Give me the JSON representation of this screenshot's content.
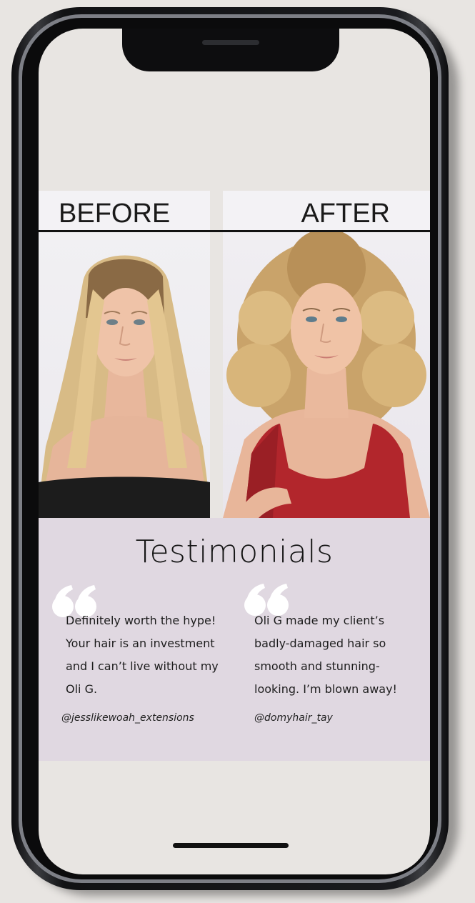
{
  "before_after": {
    "before_label": "BEFORE",
    "after_label": "AFTER"
  },
  "testimonials": {
    "title": "Testimonials",
    "items": [
      {
        "quote": "Definitely worth the hype!\nYour hair is an investment\nand I can’t live without my\nOli G.",
        "handle": "@jesslikewoah_extensions"
      },
      {
        "quote": "Oli G made my client’s\nbadly-damaged hair so\nsmooth and stunning-\nlooking. I’m blown away!",
        "handle": "@domyhair_tay"
      }
    ]
  },
  "colors": {
    "background": "#e8e5e2",
    "testimonial_panel": "#e0d8e1",
    "quote_mark": "#ffffff",
    "phone_frame": "#1a1b1e"
  },
  "icons": {
    "quote_mark": "quote-icon"
  }
}
